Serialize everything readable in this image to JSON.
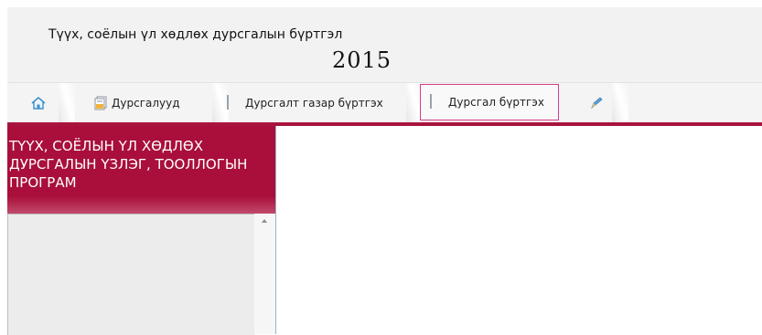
{
  "header": {
    "title": "Түүх, соёлын үл хөдлөх дурсгалын бүртгэл",
    "year": "2015"
  },
  "tabs": [
    {
      "label": "",
      "icon": "home-icon"
    },
    {
      "label": "Дурсгалууд",
      "icon": "document-stack-icon"
    },
    {
      "label": "Дурсгалт газар бүртгэх",
      "icon": "document-icon"
    },
    {
      "label": "Дурсгал бүртгэх",
      "icon": "document-icon",
      "selected": true
    },
    {
      "label": "",
      "icon": "pencil-icon"
    }
  ],
  "sidebar": {
    "title": "ТҮҮХ, СОЁЛЫН ҮЛ ХӨДЛӨХ ДУРСГАЛЫН ҮЗЛЭГ, ТООЛЛОГЫН ПРОГРАМ"
  },
  "colors": {
    "accent": "#a8143e",
    "selected_tab_border": "#d63c8a"
  }
}
